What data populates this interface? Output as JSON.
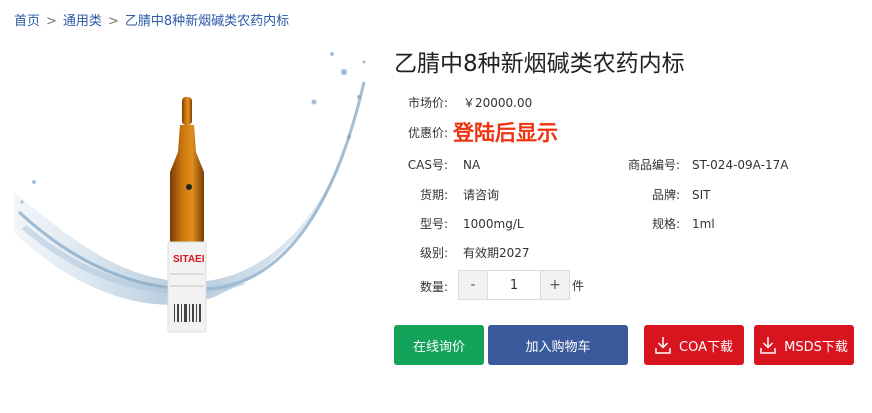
{
  "breadcrumb": {
    "home": "首页",
    "category": "通用类",
    "current": "乙腈中8种新烟碱类农药内标",
    "separator": ">"
  },
  "product": {
    "title": "乙腈中8种新烟碱类农药内标",
    "vial_label_text": "SITAEI",
    "market_price_label": "市场价:",
    "market_price": "￥20000.00",
    "promo_label": "优惠价:",
    "promo_text": "登陆后显示",
    "cas_label": "CAS号:",
    "cas": "NA",
    "item_no_label": "商品编号:",
    "item_no": "ST-024-09A-17A",
    "stock_label": "货期:",
    "stock": "请咨询",
    "brand_label": "品牌:",
    "brand": "SIT",
    "model_label": "型号:",
    "model": "1000mg/L",
    "spec_label": "规格:",
    "spec": "1ml",
    "grade_label": "级别:",
    "grade": "有效期2027",
    "qty_label": "数量:",
    "qty_minus": "-",
    "qty_plus": "+",
    "qty_value": "1",
    "qty_unit": "件"
  },
  "actions": {
    "inquiry": "在线询价",
    "cart": "加入购物车",
    "coa": "COA下载",
    "msds": "MSDS下载"
  },
  "colors": {
    "link": "#2a5aa8",
    "promo": "#ee3311",
    "inquiry_bg": "#13a35a",
    "cart_bg": "#3b5a9b",
    "download_bg": "#d8141f"
  },
  "icons": {
    "download": "download-icon"
  }
}
